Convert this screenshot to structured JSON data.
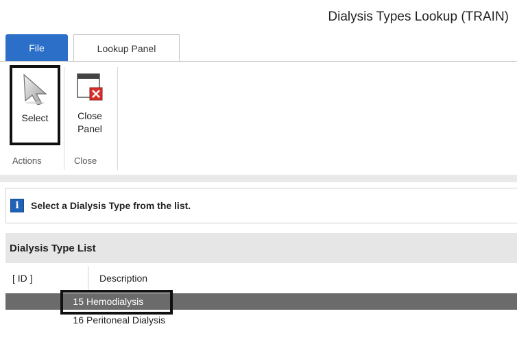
{
  "window": {
    "title": "Dialysis Types Lookup (TRAIN)"
  },
  "ribbon": {
    "tabs": [
      {
        "label": "File",
        "color": "#2b6fc9"
      },
      {
        "label": "Lookup Panel"
      }
    ],
    "buttons": {
      "select_label": "Select",
      "close_label_line1": "Close",
      "close_label_line2": "Panel"
    },
    "groups": {
      "actions": "Actions",
      "close": "Close"
    }
  },
  "info": {
    "icon": "info-icon",
    "message": "Select a Dialysis Type from the list."
  },
  "list": {
    "title": "Dialysis Type List",
    "columns": {
      "id": "[ ID ]",
      "description": "Description"
    },
    "rows": [
      {
        "id": "15",
        "description": "Hemodialysis",
        "selected": true
      },
      {
        "id": "16",
        "description": "Peritoneal Dialysis",
        "selected": false
      }
    ],
    "selected_row_color": "#6b6b6b"
  }
}
